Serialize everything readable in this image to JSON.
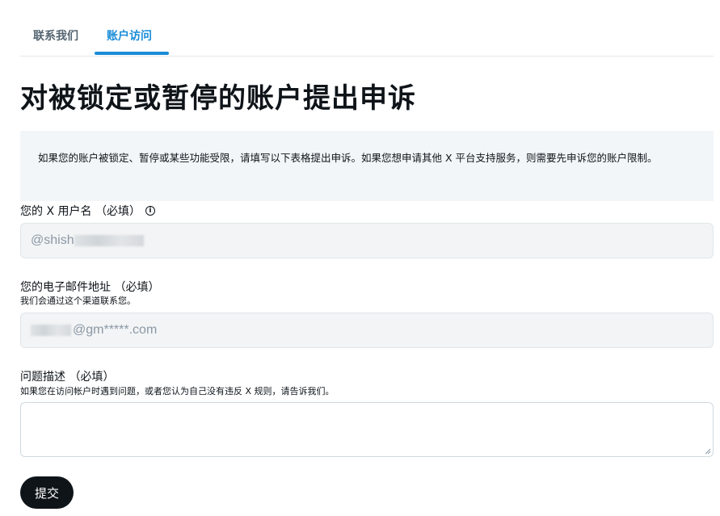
{
  "tabs": {
    "contact_label": "联系我们",
    "access_label": "账户访问",
    "active": "账户访问"
  },
  "page": {
    "title": "对被锁定或暂停的账户提出申诉"
  },
  "notice": {
    "text": "如果您的账户被锁定、暂停或某些功能受限，请填写以下表格提出申诉。如果您想申请其他 X 平台支持服务，则需要先申诉您的账户限制。"
  },
  "username": {
    "label": "您的 X 用户名 （必填）",
    "info_icon": "info-icon",
    "value": "@shish"
  },
  "email": {
    "label": "您的电子邮件地址 （必填）",
    "hint": "我们会通过这个渠道联系您。",
    "value": "@gm*****.com"
  },
  "description": {
    "label": "问题描述 （必填）",
    "hint": "如果您在访问帐户时遇到问题，或者您认为自己没有违反 X 规则，请告诉我们。",
    "value": ""
  },
  "submit": {
    "label": "提交"
  },
  "colors": {
    "accent": "#1a8cd8",
    "button_bg": "#0f1419",
    "notice_bg": "#f2f6f9"
  }
}
